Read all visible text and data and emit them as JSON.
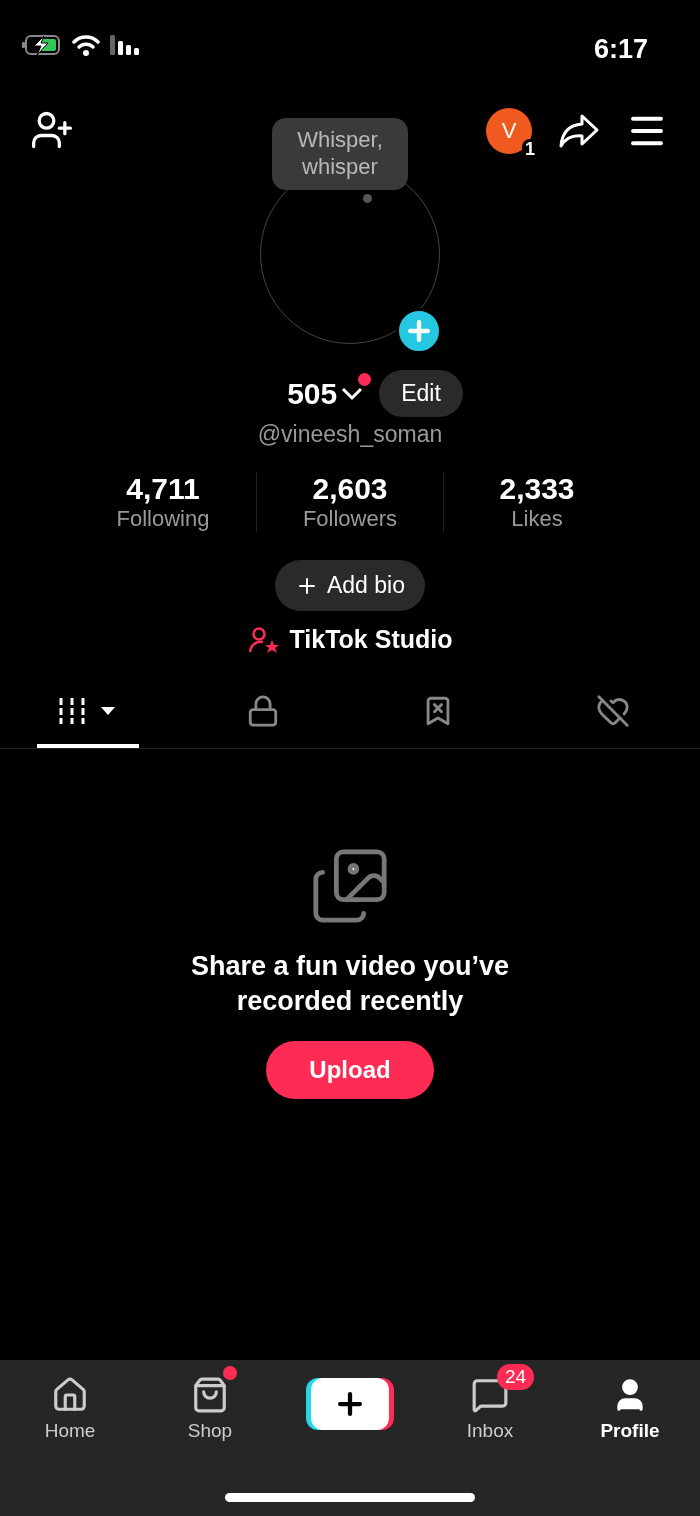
{
  "status_bar": {
    "time": "6:17"
  },
  "header": {
    "account_initial": "V",
    "account_badge": "1"
  },
  "tooltip": {
    "text": "Whisper, whisper"
  },
  "profile": {
    "name": "505",
    "has_notification": true,
    "edit_button": "Edit",
    "handle": "@vineesh_soman"
  },
  "stats": [
    {
      "value": "4,711",
      "label": "Following"
    },
    {
      "value": "2,603",
      "label": "Followers"
    },
    {
      "value": "2,333",
      "label": "Likes"
    }
  ],
  "add_bio": "Add bio",
  "studio": "TikTok Studio",
  "content_tabs": [
    {
      "kind": "grid",
      "selected": true
    },
    {
      "kind": "lock",
      "selected": false
    },
    {
      "kind": "saved",
      "selected": false
    },
    {
      "kind": "liked",
      "selected": false
    }
  ],
  "empty_state": {
    "message": "Share a fun video you’ve recorded recently",
    "button": "Upload"
  },
  "nav": [
    {
      "kind": "home",
      "label": "Home",
      "selected": false,
      "has_notification": false
    },
    {
      "kind": "shop",
      "label": "Shop",
      "selected": false,
      "has_notification": true
    },
    {
      "kind": "create",
      "selected": false,
      "has_notification": false
    },
    {
      "kind": "inbox",
      "label": "Inbox",
      "badge": "24",
      "selected": false,
      "has_notification": false
    },
    {
      "kind": "profile",
      "label": "Profile",
      "selected": true,
      "has_notification": false
    }
  ]
}
